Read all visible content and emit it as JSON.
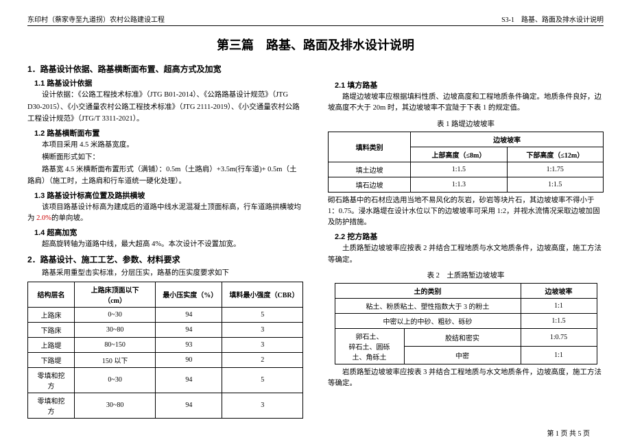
{
  "header": {
    "left": "东印村（蔡家寺至九道拐）农村公路建设工程",
    "right": "S3-1　路基、路面及排水设计说明"
  },
  "title": "第三篇　路基、路面及排水设计说明",
  "left": {
    "h1": "1．路基设计依据、路基横断面布置、超高方式及加宽",
    "h2_1": "1.1 路基设计依据",
    "p1a": "设计依据：《公路工程技术标准》（JTG B01-2014）、《公路路基设计规范》（JTG",
    "p1b": "D30-2015）、《小交通量农村公路工程技术标准》（JTG 2111-2019）、《小交通量农村公路工程设计规范》（JTG/T 3311-2021）。",
    "h2_2": "1.2 路基横断面布置",
    "p2a": "本项目采用 4.5 米路基宽度。",
    "p2b": "横断面形式如下：",
    "p2c": "路基宽 4.5 米横断面布置形式（满铺）：0.5m（土路肩）+3.5m(行车道)+ 0.5m（土路肩）（施工时，土路肩和行车道统一硬化处理）。",
    "h2_3": "1.3 路基设计标高位置及路拱横坡",
    "p3a_pre": "该项目路基设计标高为建成后的道路中线水泥混凝土顶面标高，行车道路拱横坡均为 ",
    "p3a_red": "2.0%",
    "p3a_post": "的单向坡。",
    "h2_4": "1.4 超高加宽",
    "p4a": "超高旋转轴为道路中线，最大超高 4%。本次设计不设置加宽。",
    "h1_2": "2．路基设计、施工工艺、参数、材料要求",
    "p5": "路基采用重型击实标准，分层压实，路基的压实度要求如下",
    "tbl": {
      "head": [
        "结构层名",
        "上路床顶面以下（cm）",
        "最小压实度（%）",
        "填料最小强度（CBR）"
      ],
      "rows": [
        [
          "上路床",
          "0~30",
          "94",
          "5"
        ],
        [
          "下路床",
          "30~80",
          "94",
          "3"
        ],
        [
          "上路堤",
          "80~150",
          "93",
          "3"
        ],
        [
          "下路堤",
          "150 以下",
          "90",
          "2"
        ],
        [
          "零填和挖方",
          "0~30",
          "94",
          "5"
        ],
        [
          "零填和挖方",
          "30~80",
          "94",
          "3"
        ]
      ]
    }
  },
  "right": {
    "h2_1": "2.1 填方路基",
    "p1": "路堤边坡坡率应根据填料性质、边坡高度和工程地质条件确定。地质条件良好，边坡高度不大于 20m 时，其边坡坡率不宜陡于下表 1 的规定值。",
    "tcap1": "表 1 路堤边坡坡率",
    "tbl1": {
      "head1": "填料类别",
      "head2": "边坡坡率",
      "sub1": "上部高度（≤8m）",
      "sub2": "下部高度（≤12m）",
      "rows": [
        [
          "填土边坡",
          "1:1.5",
          "1:1.75"
        ],
        [
          "填石边坡",
          "1:1.3",
          "1:1.5"
        ]
      ]
    },
    "p2": "砌石路基中的石材应选用当地不易风化的灰岩，砂岩等块片石，其边坡坡率不得小于 1：0.75。浸水路堤在设计水位以下的边坡坡率可采用 1:2，并视水流情况采取边坡加固及防护措施。",
    "h2_2": "2.2 挖方路基",
    "p3": "土质路堑边坡坡率应按表 2 并结合工程地质与水文地质条件，边坡高度，施工方法等确定。",
    "tcap2": "表 2　土质路堑边坡坡率",
    "tbl2": {
      "head": [
        "土的类别",
        "边坡坡率"
      ],
      "rows": [
        [
          [
            "粘土、粉质粘土、塑性指数大于 3 的粉土"
          ],
          "1:1"
        ],
        [
          [
            "中密以上的中砂、粗砂、砾砂"
          ],
          "1:1.5"
        ]
      ],
      "grouprow": {
        "left": "卵石土、\n碎石土、圆砾\n土、角砾土",
        "a": [
          "胶结和密实",
          "1:0.75"
        ],
        "b": [
          "中密",
          "1:1"
        ]
      }
    },
    "p4": "岩质路堑边坡坡率应按表 3 并结合工程地质与水文地质条件，边坡高度，施工方法等确定。"
  },
  "footer": "第 1 页 共 5 页"
}
